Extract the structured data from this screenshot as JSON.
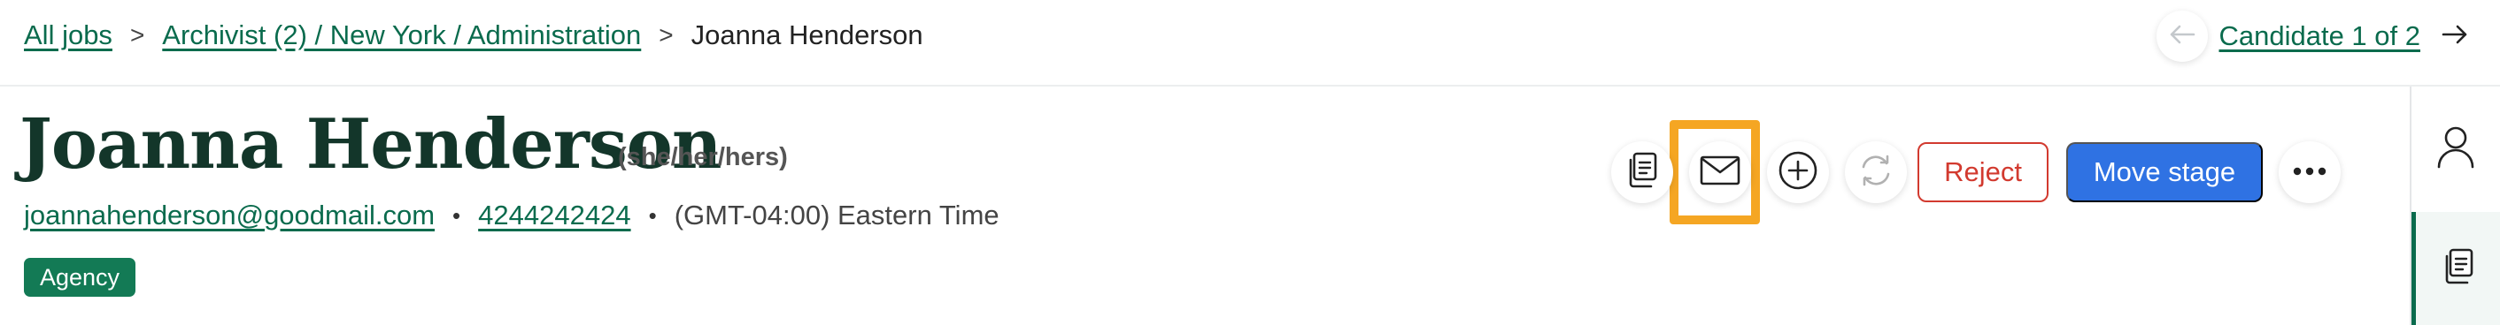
{
  "breadcrumb": {
    "all_jobs": "All jobs",
    "job": "Archivist (2) / New York / Administration",
    "current": "Joanna Henderson"
  },
  "candidate_nav": {
    "label": "Candidate 1 of 2"
  },
  "candidate": {
    "name": "Joanna Henderson",
    "pronouns": "(she/her/hers)",
    "email": "joannahenderson@goodmail.com",
    "phone": "4244242424",
    "timezone": "(GMT-04:00) Eastern Time",
    "tag": "Agency"
  },
  "actions": {
    "reject_label": "Reject",
    "move_stage_label": "Move stage"
  },
  "colors": {
    "brand_green": "#0a6b4d",
    "tag_green": "#137a55",
    "primary_blue": "#2f72e3",
    "reject_red": "#d23a2f",
    "highlight_orange": "#f5a623"
  },
  "icons": [
    "arrow-left-icon",
    "arrow-right-icon",
    "copy-documents-icon",
    "mail-icon",
    "plus-circle-icon",
    "sync-icon",
    "more-icon",
    "person-icon",
    "documents-icon"
  ]
}
